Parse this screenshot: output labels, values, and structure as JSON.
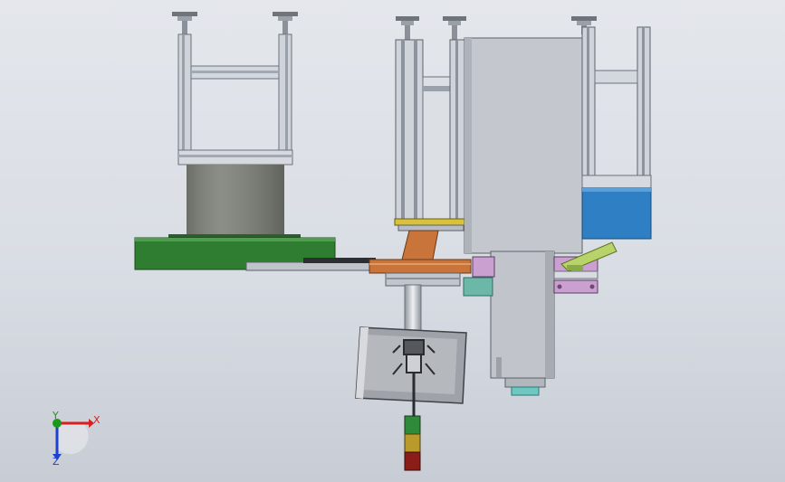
{
  "viewport": {
    "background_top": "#e4e7ec",
    "background_bottom": "#c8ccd4"
  },
  "triad": {
    "x_label": "X",
    "y_label": "Y",
    "z_label": "Z",
    "x_color": "#d62020",
    "y_color": "#1a9a1a",
    "z_color": "#1f3fd0"
  },
  "colors": {
    "aluminum": "#c9ced6",
    "aluminum_dark": "#8e949e",
    "steel_gray": "#b8bcc4",
    "cylinder": "#7d8078",
    "base_green": "#2f7d31",
    "blue_block": "#2f7fc4",
    "copper": "#c8743a",
    "yellow": "#d8c23a",
    "purple": "#c9a0cf",
    "lime": "#b7d36a",
    "teal": "#6fc7c2",
    "stack_green": "#2f8a3a",
    "stack_yellow": "#b99a2a",
    "stack_red": "#8a1d18"
  }
}
